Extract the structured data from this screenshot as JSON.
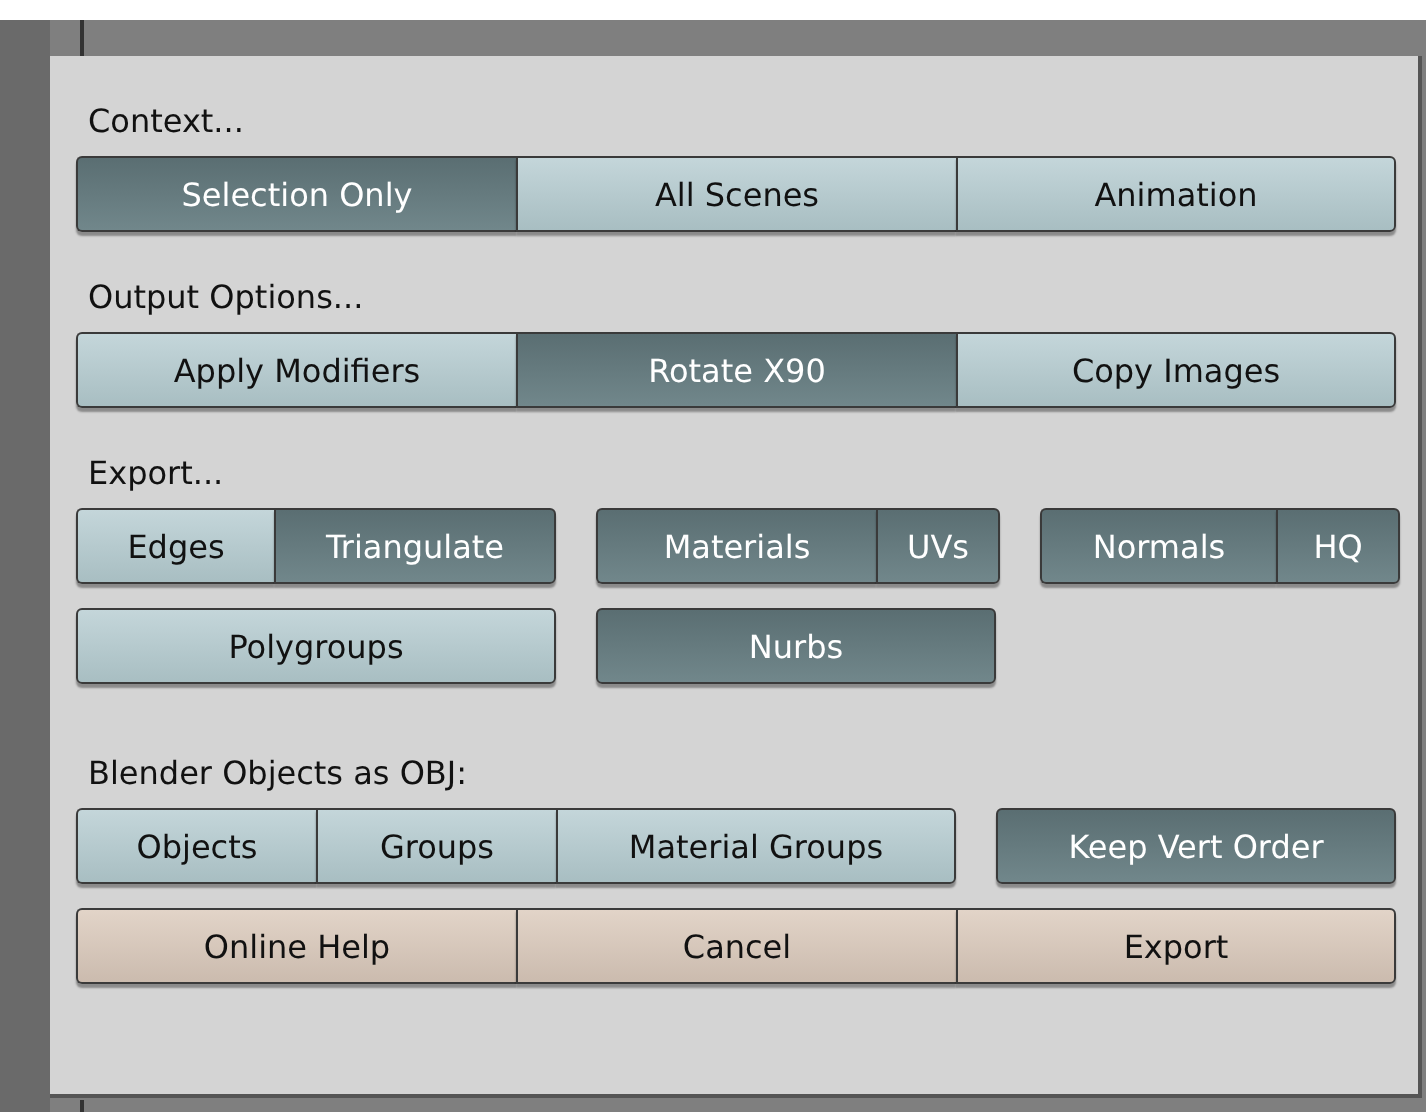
{
  "sections": [
    {
      "label": "Context...",
      "rows": [
        [
          [
            {
              "label": "Selection Only",
              "kind": "toggle",
              "selected": true
            },
            {
              "label": "All Scenes",
              "kind": "toggle",
              "selected": false
            },
            {
              "label": "Animation",
              "kind": "toggle",
              "selected": false
            }
          ]
        ]
      ]
    },
    {
      "label": "Output Options...",
      "rows": [
        [
          [
            {
              "label": "Apply Modifiers",
              "kind": "toggle",
              "selected": false
            },
            {
              "label": "Rotate X90",
              "kind": "toggle",
              "selected": true
            },
            {
              "label": "Copy Images",
              "kind": "toggle",
              "selected": false
            }
          ]
        ]
      ]
    },
    {
      "label": "Export...",
      "rows": [
        [
          [
            {
              "label": "Edges",
              "kind": "toggle",
              "selected": false
            },
            {
              "label": "Triangulate",
              "kind": "toggle",
              "selected": true
            }
          ],
          [
            {
              "label": "Materials",
              "kind": "toggle",
              "selected": true
            },
            {
              "label": "UVs",
              "kind": "toggle",
              "selected": true
            }
          ],
          [
            {
              "label": "Normals",
              "kind": "toggle",
              "selected": true
            },
            {
              "label": "HQ",
              "kind": "toggle",
              "selected": true
            }
          ]
        ],
        [
          [
            {
              "label": "Polygroups",
              "kind": "toggle",
              "selected": false
            }
          ],
          [
            {
              "label": "Nurbs",
              "kind": "toggle",
              "selected": true
            }
          ]
        ]
      ]
    },
    {
      "label": "Blender Objects as OBJ:",
      "rows": [
        [
          [
            {
              "label": "Objects",
              "kind": "toggle",
              "selected": false
            },
            {
              "label": "Groups",
              "kind": "toggle",
              "selected": false
            },
            {
              "label": "Material Groups",
              "kind": "toggle",
              "selected": false
            }
          ],
          [
            {
              "label": "Keep Vert Order",
              "kind": "toggle",
              "selected": true
            }
          ]
        ],
        [
          [
            {
              "label": "Online Help",
              "kind": "action"
            },
            {
              "label": "Cancel",
              "kind": "action"
            },
            {
              "label": "Export",
              "kind": "action"
            }
          ]
        ]
      ]
    }
  ]
}
